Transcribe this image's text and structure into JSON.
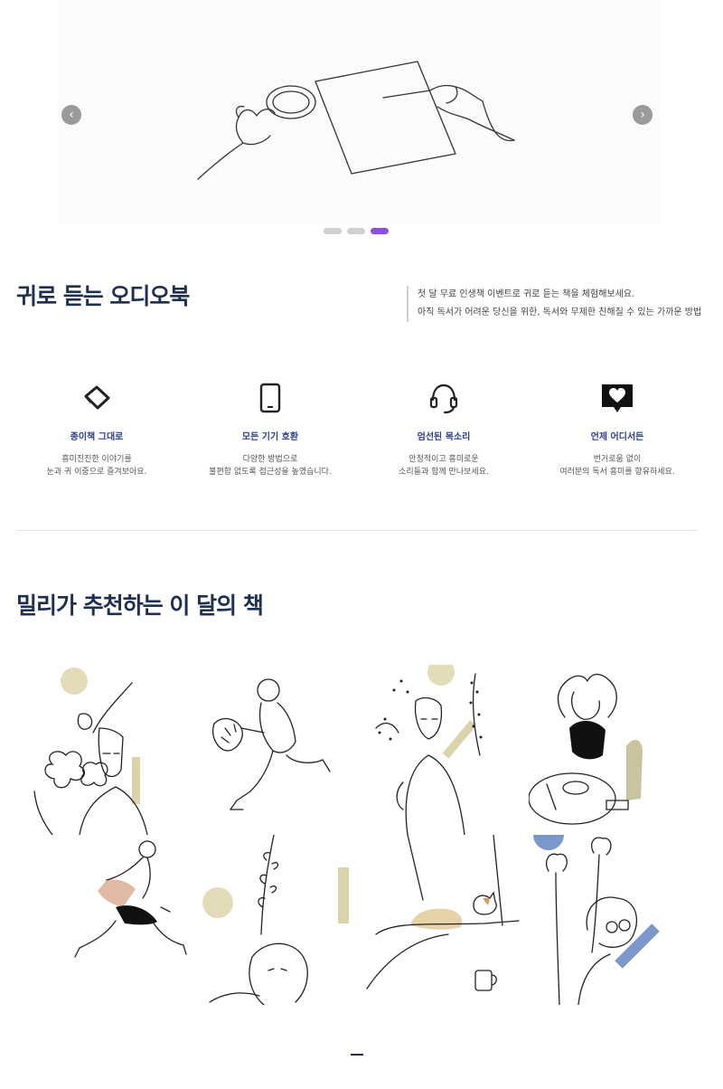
{
  "slider": {
    "prev_icon": "chevron-left-icon",
    "next_icon": "chevron-right-icon",
    "prev_label": "‹",
    "next_label": "›",
    "slide_count": 3,
    "active_slide": 3
  },
  "audiobook": {
    "title": "귀로 듣는 오디오북",
    "intro_line1": "첫 달 무료 인생책 이벤트로 귀로 듣는 책을 체험해보세요.",
    "intro_line2": "아직 독서가 어려운 당신을 위한, 독서와 무제한 친해질 수 있는 가까운 방법",
    "features": [
      {
        "icon": "eraser-icon",
        "name": "종이책 그대로",
        "desc": "흥미진진한 이야기를\n눈과 귀 이중으로 즐겨보아요."
      },
      {
        "icon": "tablet-icon",
        "name": "모든 기기 호환",
        "desc": "다양한 방법으로\n불편함 없도록 접근성을 높였습니다."
      },
      {
        "icon": "headset-icon",
        "name": "엄선된 목소리",
        "desc": "안정적이고 흥미로운\n소리들과 함께 만나보세요."
      },
      {
        "icon": "heart-chat-icon",
        "name": "언제 어디서든",
        "desc": "번거로움 없이\n여러분의 독서 흥미를 향유하세요."
      }
    ]
  },
  "recommend": {
    "title": "밀리가 추천하는 이 달의 책",
    "books": [
      {
        "illustration": "person-with-flowers-illustration"
      },
      {
        "illustration": "running-with-bouquet-illustration"
      },
      {
        "illustration": "person-with-vine-illustration"
      },
      {
        "illustration": "person-at-cafe-table-illustration"
      },
      {
        "illustration": "woman-dancing-illustration"
      },
      {
        "illustration": "sleeping-person-with-plant-illustration"
      },
      {
        "illustration": "napping-with-cat-illustration"
      },
      {
        "illustration": "person-with-glasses-illustration"
      }
    ]
  },
  "colors": {
    "accent": "#8d4fe0",
    "title": "#1f2f52",
    "feature_name": "#2a3f8f",
    "beige": "#e0d7b5",
    "blue": "#7a98c9"
  }
}
